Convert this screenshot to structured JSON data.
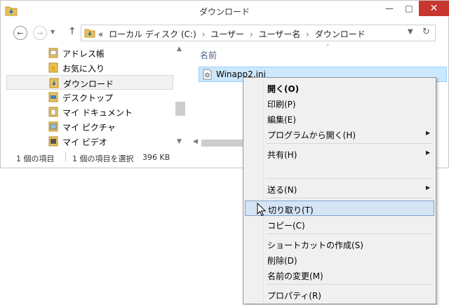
{
  "window": {
    "title": "ダウンロード",
    "controls": {
      "minimize": "—",
      "maximize": "□",
      "close": "✕"
    }
  },
  "navbar": {
    "back_icon": "←",
    "forward_icon": "→",
    "recent_icon": "▼",
    "up_icon": "↑",
    "address_prefix": "«",
    "breadcrumbs": [
      "ローカル ディスク (C:)",
      "ユーザー",
      "ユーザー名",
      "ダウンロード"
    ],
    "breadcrumb_separator": "›",
    "dropdown_icon": "▼",
    "refresh_icon": "↻"
  },
  "sidebar": {
    "items": [
      {
        "label": "アドレス帳",
        "icon": "address-book-icon"
      },
      {
        "label": "お気に入り",
        "icon": "favorites-icon"
      },
      {
        "label": "ダウンロード",
        "icon": "downloads-folder-icon",
        "selected": true
      },
      {
        "label": "デスクトップ",
        "icon": "desktop-folder-icon"
      },
      {
        "label": "マイ ドキュメント",
        "icon": "documents-folder-icon"
      },
      {
        "label": "マイ ピクチャ",
        "icon": "pictures-folder-icon"
      },
      {
        "label": "マイ ビデオ",
        "icon": "videos-folder-icon"
      }
    ],
    "scroll_up": "▲",
    "scroll_down": "▼"
  },
  "file_list": {
    "column_header": "名前",
    "sort_indicator": "˄",
    "files": [
      {
        "name": "Winapp2.ini",
        "icon": "settings-file-icon"
      }
    ],
    "scroll_left": "◀"
  },
  "statusbar": {
    "item_count": "1 個の項目",
    "selected_text": "1 個の項目を選択",
    "selected_size": "396 KB"
  },
  "context_menu": {
    "items": [
      {
        "label": "開く(O)",
        "bold": true
      },
      {
        "label": "印刷(P)"
      },
      {
        "label": "編集(E)"
      },
      {
        "label": "プログラムから開く(H)",
        "submenu": true
      },
      {
        "separator": true
      },
      {
        "label": "共有(H)",
        "submenu": true
      },
      {
        "label": ""
      },
      {
        "separator": true
      },
      {
        "label": "送る(N)",
        "submenu": true
      },
      {
        "separator": true
      },
      {
        "label": "切り取り(T)",
        "highlighted": true
      },
      {
        "label": "コピー(C)"
      },
      {
        "separator": true
      },
      {
        "label": "ショートカットの作成(S)"
      },
      {
        "label": "削除(D)"
      },
      {
        "label": "名前の変更(M)"
      },
      {
        "separator": true
      },
      {
        "label": "プロパティ(R)"
      }
    ],
    "submenu_arrow": "▶"
  },
  "colors": {
    "selection_bg": "#cce8ff",
    "selection_border": "#99d1ff",
    "menu_highlight": "#d5e4f5",
    "close_button": "#c7372f",
    "folder_yellow": "#e8c15a"
  }
}
